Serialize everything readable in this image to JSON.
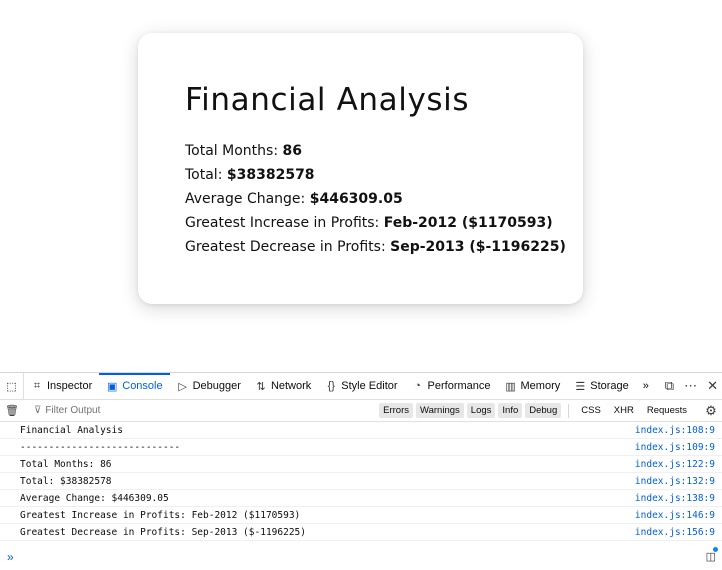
{
  "card": {
    "title": "Financial Analysis",
    "stats": [
      {
        "label": "Total Months: ",
        "value": "86"
      },
      {
        "label": "Total: ",
        "value": "$38382578"
      },
      {
        "label": "Average Change: ",
        "value": "$446309.05"
      },
      {
        "label": "Greatest Increase in Profits: ",
        "value": "Feb-2012 ($1170593)"
      },
      {
        "label": "Greatest Decrease in Profits: ",
        "value": "Sep-2013 ($-1196225)"
      }
    ]
  },
  "devtools": {
    "tabs": [
      {
        "label": "Inspector",
        "icon": "inspector-icon",
        "glyph": "⌗"
      },
      {
        "label": "Console",
        "icon": "console-icon",
        "glyph": "▣"
      },
      {
        "label": "Debugger",
        "icon": "debugger-icon",
        "glyph": "▷"
      },
      {
        "label": "Network",
        "icon": "network-icon",
        "glyph": "⇅"
      },
      {
        "label": "Style Editor",
        "icon": "style-editor-icon",
        "glyph": "{}"
      },
      {
        "label": "Performance",
        "icon": "performance-icon",
        "glyph": "◔"
      },
      {
        "label": "Memory",
        "icon": "memory-icon",
        "glyph": "▥"
      },
      {
        "label": "Storage",
        "icon": "storage-icon",
        "glyph": "☰"
      }
    ],
    "active_tab": "Console",
    "filter_placeholder": "Filter Output",
    "levels": [
      "Errors",
      "Warnings",
      "Logs",
      "Info",
      "Debug"
    ],
    "extra_filters": [
      "CSS",
      "XHR",
      "Requests"
    ],
    "logs": [
      {
        "message": "Financial Analysis",
        "source": "index.js:108:9"
      },
      {
        "message": "----------------------------",
        "source": "index.js:109:9"
      },
      {
        "message": "Total Months: 86",
        "source": "index.js:122:9"
      },
      {
        "message": "Total: $38382578",
        "source": "index.js:132:9"
      },
      {
        "message": "Average Change: $446309.05",
        "source": "index.js:138:9"
      },
      {
        "message": "Greatest Increase in Profits: Feb-2012 ($1170593)",
        "source": "index.js:146:9"
      },
      {
        "message": "Greatest Decrease in Profits: Sep-2013 ($-1196225)",
        "source": "index.js:156:9"
      }
    ],
    "accent_color": "#0060df"
  }
}
